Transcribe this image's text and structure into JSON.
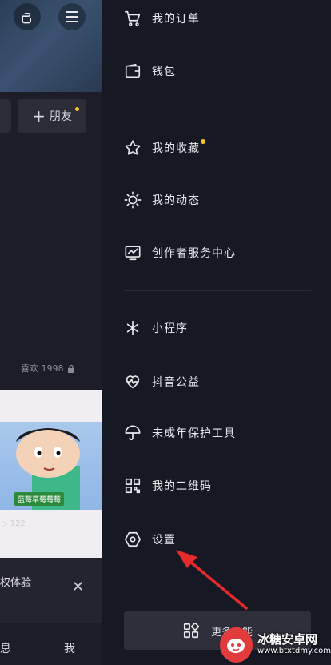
{
  "left_panel": {
    "add_friend_label": "朋友",
    "liked_text": "喜欢 1998",
    "thumb_caption": "蓝莓草莓莓莓",
    "play_count": "122",
    "promo_text": "权体验",
    "tab_left": "息",
    "tab_right": "我"
  },
  "drawer": {
    "items": [
      {
        "label": "我的订单",
        "icon": "cart-icon"
      },
      {
        "label": "钱包",
        "icon": "wallet-icon"
      },
      {
        "label": "我的收藏",
        "icon": "star-icon",
        "badge": true
      },
      {
        "label": "我的动态",
        "icon": "sun-icon"
      },
      {
        "label": "创作者服务中心",
        "icon": "monitor-icon"
      },
      {
        "label": "小程序",
        "icon": "asterisk-icon"
      },
      {
        "label": "抖音公益",
        "icon": "heart-icon"
      },
      {
        "label": "未成年保护工具",
        "icon": "umbrella-icon"
      },
      {
        "label": "我的二维码",
        "icon": "qrcode-icon"
      },
      {
        "label": "设置",
        "icon": "settings-icon"
      }
    ],
    "more_label": "更多功能"
  },
  "watermark": {
    "title": "冰糖安卓网",
    "url": "www.btxtdmy.com"
  },
  "colors": {
    "background": "#161823",
    "badge": "#f5c518",
    "arrow": "#e52b2b"
  }
}
